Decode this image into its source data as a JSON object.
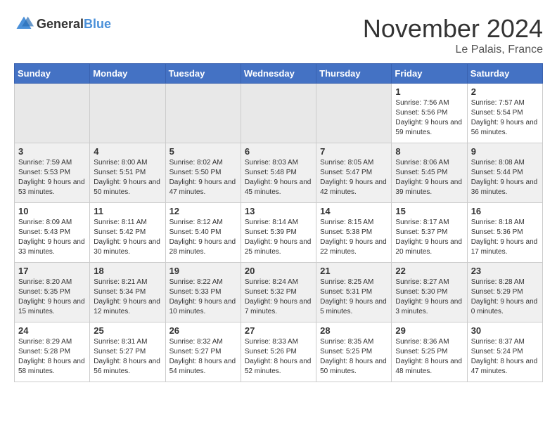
{
  "logo": {
    "general": "General",
    "blue": "Blue"
  },
  "title": "November 2024",
  "location": "Le Palais, France",
  "days_of_week": [
    "Sunday",
    "Monday",
    "Tuesday",
    "Wednesday",
    "Thursday",
    "Friday",
    "Saturday"
  ],
  "weeks": [
    [
      {
        "day": "",
        "sunrise": "",
        "sunset": "",
        "daylight": ""
      },
      {
        "day": "",
        "sunrise": "",
        "sunset": "",
        "daylight": ""
      },
      {
        "day": "",
        "sunrise": "",
        "sunset": "",
        "daylight": ""
      },
      {
        "day": "",
        "sunrise": "",
        "sunset": "",
        "daylight": ""
      },
      {
        "day": "",
        "sunrise": "",
        "sunset": "",
        "daylight": ""
      },
      {
        "day": "1",
        "sunrise": "Sunrise: 7:56 AM",
        "sunset": "Sunset: 5:56 PM",
        "daylight": "Daylight: 9 hours and 59 minutes."
      },
      {
        "day": "2",
        "sunrise": "Sunrise: 7:57 AM",
        "sunset": "Sunset: 5:54 PM",
        "daylight": "Daylight: 9 hours and 56 minutes."
      }
    ],
    [
      {
        "day": "3",
        "sunrise": "Sunrise: 7:59 AM",
        "sunset": "Sunset: 5:53 PM",
        "daylight": "Daylight: 9 hours and 53 minutes."
      },
      {
        "day": "4",
        "sunrise": "Sunrise: 8:00 AM",
        "sunset": "Sunset: 5:51 PM",
        "daylight": "Daylight: 9 hours and 50 minutes."
      },
      {
        "day": "5",
        "sunrise": "Sunrise: 8:02 AM",
        "sunset": "Sunset: 5:50 PM",
        "daylight": "Daylight: 9 hours and 47 minutes."
      },
      {
        "day": "6",
        "sunrise": "Sunrise: 8:03 AM",
        "sunset": "Sunset: 5:48 PM",
        "daylight": "Daylight: 9 hours and 45 minutes."
      },
      {
        "day": "7",
        "sunrise": "Sunrise: 8:05 AM",
        "sunset": "Sunset: 5:47 PM",
        "daylight": "Daylight: 9 hours and 42 minutes."
      },
      {
        "day": "8",
        "sunrise": "Sunrise: 8:06 AM",
        "sunset": "Sunset: 5:45 PM",
        "daylight": "Daylight: 9 hours and 39 minutes."
      },
      {
        "day": "9",
        "sunrise": "Sunrise: 8:08 AM",
        "sunset": "Sunset: 5:44 PM",
        "daylight": "Daylight: 9 hours and 36 minutes."
      }
    ],
    [
      {
        "day": "10",
        "sunrise": "Sunrise: 8:09 AM",
        "sunset": "Sunset: 5:43 PM",
        "daylight": "Daylight: 9 hours and 33 minutes."
      },
      {
        "day": "11",
        "sunrise": "Sunrise: 8:11 AM",
        "sunset": "Sunset: 5:42 PM",
        "daylight": "Daylight: 9 hours and 30 minutes."
      },
      {
        "day": "12",
        "sunrise": "Sunrise: 8:12 AM",
        "sunset": "Sunset: 5:40 PM",
        "daylight": "Daylight: 9 hours and 28 minutes."
      },
      {
        "day": "13",
        "sunrise": "Sunrise: 8:14 AM",
        "sunset": "Sunset: 5:39 PM",
        "daylight": "Daylight: 9 hours and 25 minutes."
      },
      {
        "day": "14",
        "sunrise": "Sunrise: 8:15 AM",
        "sunset": "Sunset: 5:38 PM",
        "daylight": "Daylight: 9 hours and 22 minutes."
      },
      {
        "day": "15",
        "sunrise": "Sunrise: 8:17 AM",
        "sunset": "Sunset: 5:37 PM",
        "daylight": "Daylight: 9 hours and 20 minutes."
      },
      {
        "day": "16",
        "sunrise": "Sunrise: 8:18 AM",
        "sunset": "Sunset: 5:36 PM",
        "daylight": "Daylight: 9 hours and 17 minutes."
      }
    ],
    [
      {
        "day": "17",
        "sunrise": "Sunrise: 8:20 AM",
        "sunset": "Sunset: 5:35 PM",
        "daylight": "Daylight: 9 hours and 15 minutes."
      },
      {
        "day": "18",
        "sunrise": "Sunrise: 8:21 AM",
        "sunset": "Sunset: 5:34 PM",
        "daylight": "Daylight: 9 hours and 12 minutes."
      },
      {
        "day": "19",
        "sunrise": "Sunrise: 8:22 AM",
        "sunset": "Sunset: 5:33 PM",
        "daylight": "Daylight: 9 hours and 10 minutes."
      },
      {
        "day": "20",
        "sunrise": "Sunrise: 8:24 AM",
        "sunset": "Sunset: 5:32 PM",
        "daylight": "Daylight: 9 hours and 7 minutes."
      },
      {
        "day": "21",
        "sunrise": "Sunrise: 8:25 AM",
        "sunset": "Sunset: 5:31 PM",
        "daylight": "Daylight: 9 hours and 5 minutes."
      },
      {
        "day": "22",
        "sunrise": "Sunrise: 8:27 AM",
        "sunset": "Sunset: 5:30 PM",
        "daylight": "Daylight: 9 hours and 3 minutes."
      },
      {
        "day": "23",
        "sunrise": "Sunrise: 8:28 AM",
        "sunset": "Sunset: 5:29 PM",
        "daylight": "Daylight: 9 hours and 0 minutes."
      }
    ],
    [
      {
        "day": "24",
        "sunrise": "Sunrise: 8:29 AM",
        "sunset": "Sunset: 5:28 PM",
        "daylight": "Daylight: 8 hours and 58 minutes."
      },
      {
        "day": "25",
        "sunrise": "Sunrise: 8:31 AM",
        "sunset": "Sunset: 5:27 PM",
        "daylight": "Daylight: 8 hours and 56 minutes."
      },
      {
        "day": "26",
        "sunrise": "Sunrise: 8:32 AM",
        "sunset": "Sunset: 5:27 PM",
        "daylight": "Daylight: 8 hours and 54 minutes."
      },
      {
        "day": "27",
        "sunrise": "Sunrise: 8:33 AM",
        "sunset": "Sunset: 5:26 PM",
        "daylight": "Daylight: 8 hours and 52 minutes."
      },
      {
        "day": "28",
        "sunrise": "Sunrise: 8:35 AM",
        "sunset": "Sunset: 5:25 PM",
        "daylight": "Daylight: 8 hours and 50 minutes."
      },
      {
        "day": "29",
        "sunrise": "Sunrise: 8:36 AM",
        "sunset": "Sunset: 5:25 PM",
        "daylight": "Daylight: 8 hours and 48 minutes."
      },
      {
        "day": "30",
        "sunrise": "Sunrise: 8:37 AM",
        "sunset": "Sunset: 5:24 PM",
        "daylight": "Daylight: 8 hours and 47 minutes."
      }
    ]
  ]
}
